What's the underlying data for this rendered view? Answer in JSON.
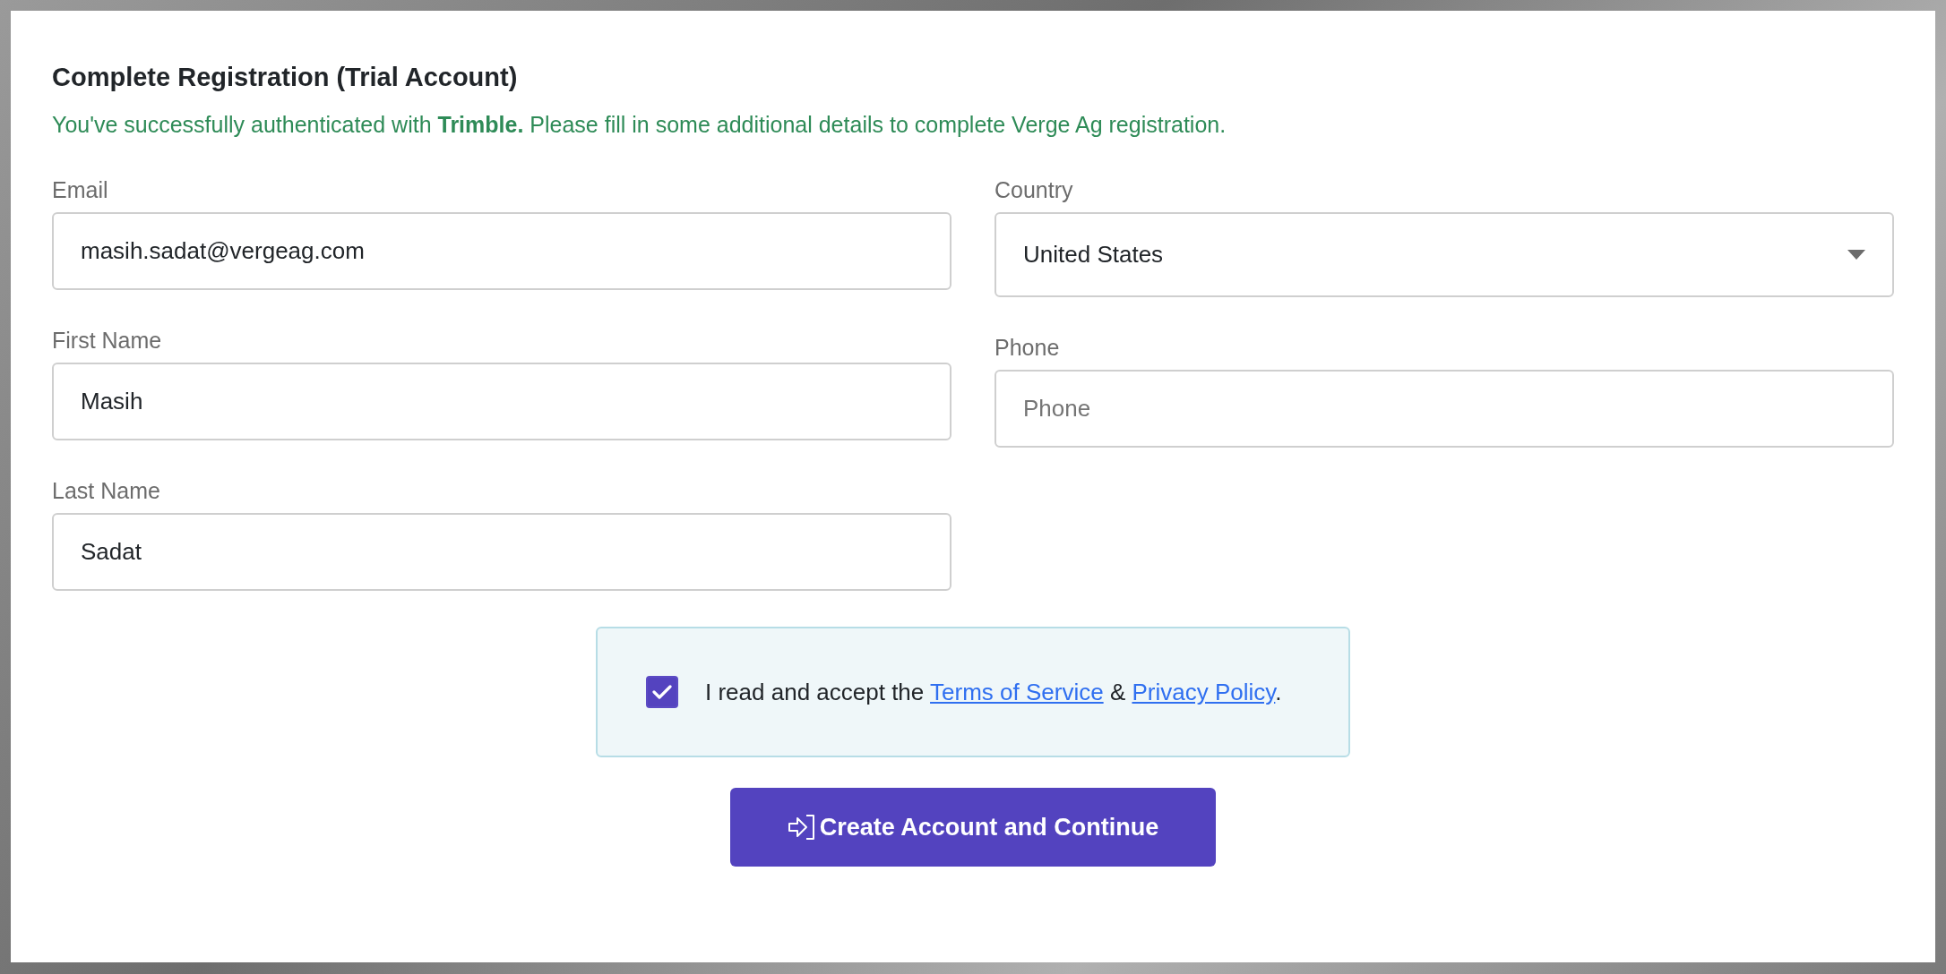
{
  "title": "Complete Registration (Trial Account)",
  "notice": "You've successfully authenticated with **Trimble.** Please fill in some additional details to complete Verge Ag registration.",
  "left_fields": [
    {
      "kind": "text",
      "label": "Email",
      "value": "masih.sadat@vergeag.com"
    },
    {
      "kind": "text",
      "label": "First Name",
      "value": "Masih"
    },
    {
      "kind": "text",
      "label": "Last Name",
      "value": "Sadat"
    }
  ],
  "right_fields": [
    {
      "kind": "select",
      "label": "Country",
      "value": "United States"
    },
    {
      "kind": "text",
      "label": "Phone",
      "placeholder": "Phone"
    }
  ],
  "agreement": {
    "checked": true,
    "prefix": "I read and accept the",
    "links": [
      "Terms of Service",
      "Privacy Policy"
    ],
    "joiner": "&",
    "suffix": "."
  },
  "submit_button": "Create Account and Continue"
}
